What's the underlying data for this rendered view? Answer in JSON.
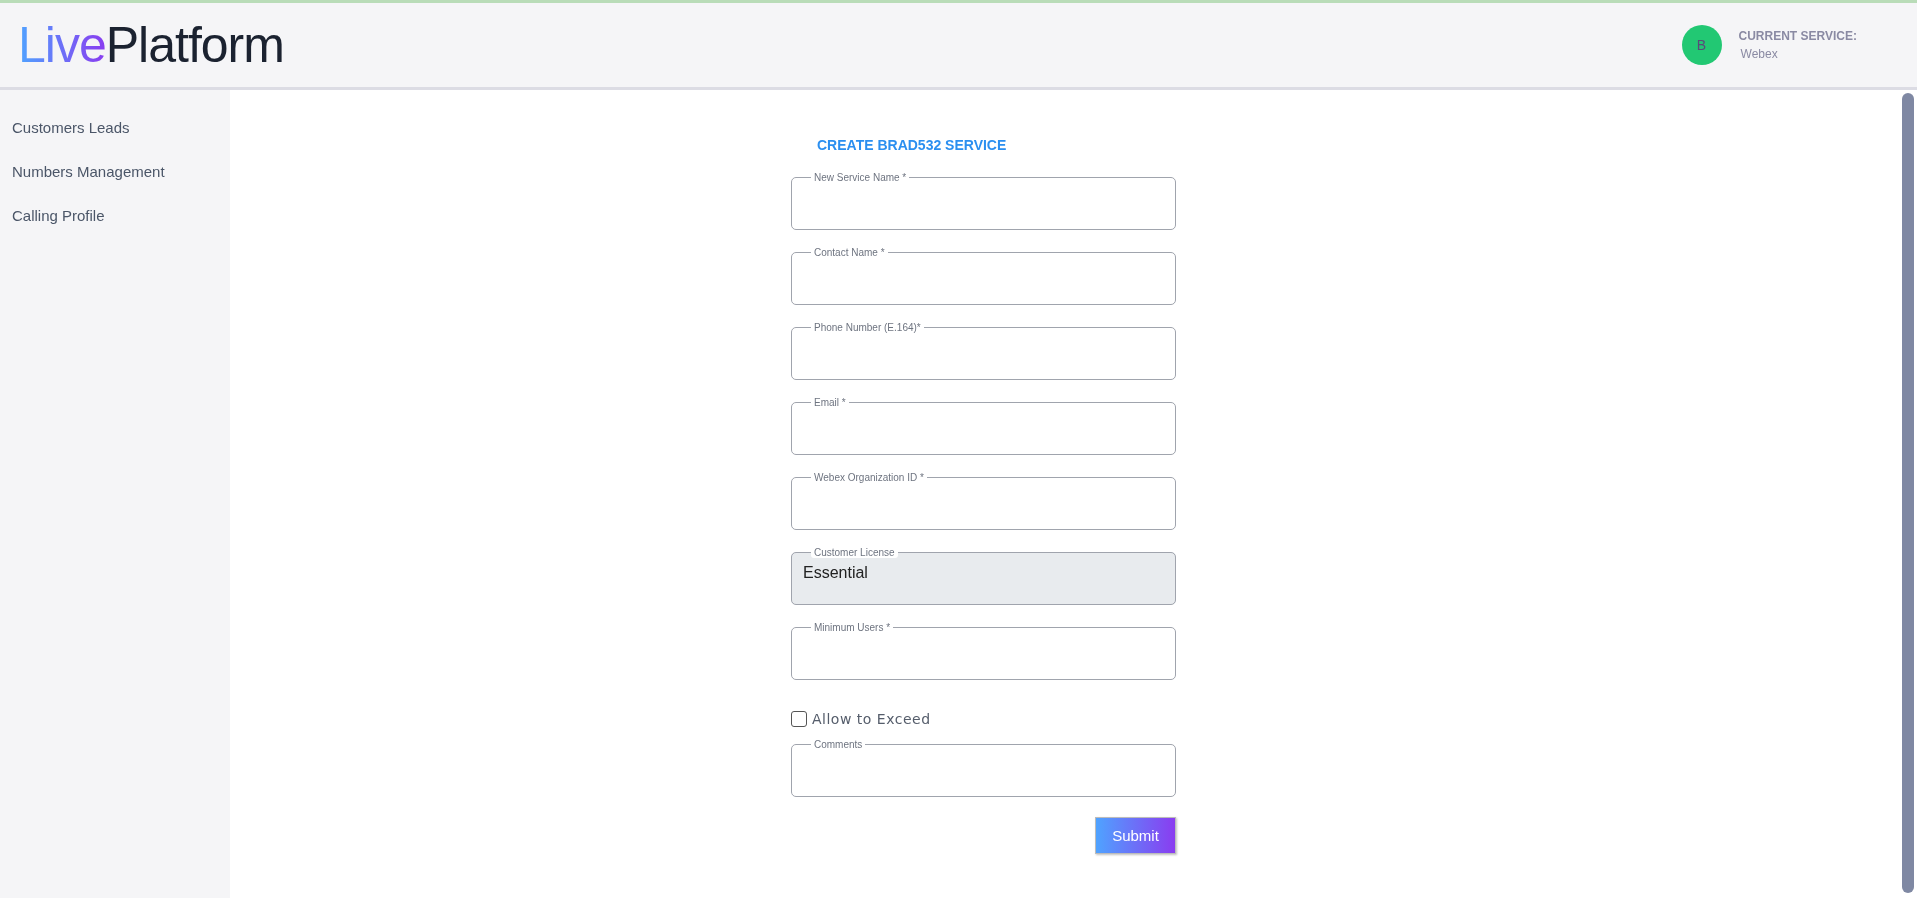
{
  "header": {
    "logo": {
      "first": "Live",
      "second": "Platform"
    },
    "avatar": "B",
    "current_service_label": "CURRENT SERVICE:",
    "current_service": "Webex"
  },
  "sidebar": {
    "items": [
      {
        "label": "Customers Leads"
      },
      {
        "label": "Numbers Management"
      },
      {
        "label": "Calling Profile"
      }
    ]
  },
  "form": {
    "title": "CREATE BRAD532 SERVICE",
    "fields": [
      {
        "kind": "text",
        "label": "New Service Name *",
        "disabled": false
      },
      {
        "kind": "text",
        "label": "Contact Name *",
        "disabled": false
      },
      {
        "kind": "text",
        "label": "Phone Number (E.164)*",
        "disabled": false
      },
      {
        "kind": "text",
        "label": "Email *",
        "disabled": false
      },
      {
        "kind": "text",
        "label": "Webex Organization ID *",
        "disabled": false
      },
      {
        "kind": "text",
        "label": "Customer License",
        "value": "Essential",
        "disabled": true
      },
      {
        "kind": "text",
        "label": "Minimum Users *",
        "disabled": false
      },
      {
        "kind": "checkbox",
        "label": "Allow to Exceed",
        "checked": false
      },
      {
        "kind": "text",
        "label": "Comments",
        "disabled": false
      }
    ],
    "submit": "Submit"
  }
}
